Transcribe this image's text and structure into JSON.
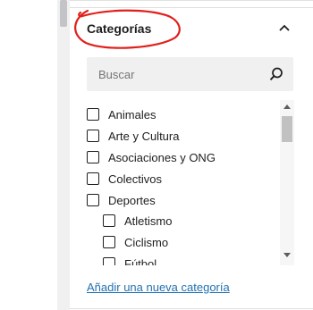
{
  "panel": {
    "title": "Categorías",
    "toggle_icon": "chevron-up-icon"
  },
  "search": {
    "placeholder": "Buscar",
    "value": "",
    "icon": "search-icon"
  },
  "categories": [
    {
      "label": "Animales",
      "checked": false,
      "level": 0
    },
    {
      "label": "Arte y Cultura",
      "checked": false,
      "level": 0
    },
    {
      "label": "Asociaciones y ONG",
      "checked": false,
      "level": 0
    },
    {
      "label": "Colectivos",
      "checked": false,
      "level": 0
    },
    {
      "label": "Deportes",
      "checked": false,
      "level": 0
    },
    {
      "label": "Atletismo",
      "checked": false,
      "level": 1
    },
    {
      "label": "Ciclismo",
      "checked": false,
      "level": 1
    },
    {
      "label": "Fútbol",
      "checked": false,
      "level": 1
    }
  ],
  "add_link": "Añadir una nueva categoría",
  "colors": {
    "link": "#2271b1",
    "annotation": "#e0201b",
    "search_bg": "#f0f0f0"
  }
}
